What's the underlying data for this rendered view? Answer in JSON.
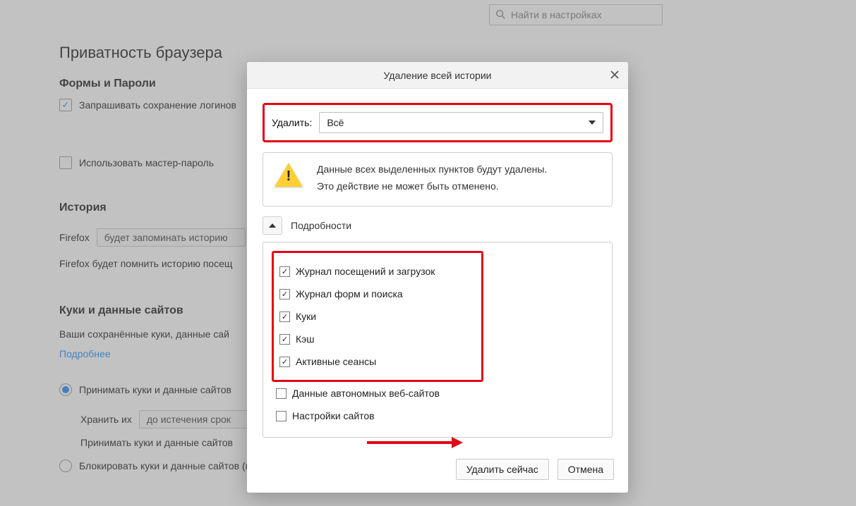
{
  "search": {
    "placeholder": "Найти в настройках"
  },
  "bg": {
    "privacy_title": "Приватность браузера",
    "forms_passwords": "Формы и Пароли",
    "ask_save_logins": "Запрашивать сохранение логинов",
    "use_master_password": "Использовать мастер-пароль",
    "history_title": "История",
    "firefox_label": "Firefox",
    "history_mode": "будет запоминать историю",
    "history_desc": "Firefox будет помнить историю посещ",
    "cookies_title": "Куки и данные сайтов",
    "cookies_desc": "Ваши сохранённые куки, данные сай",
    "learn_more": "Подробнее",
    "accept_cookies": "Принимать куки и данные сайтов",
    "keep_label": "Хранить их",
    "keep_value": "до истечения срок",
    "accept_cookies_dup": "Принимать куки и данные сайтов",
    "block_cookies": "Блокировать куки и данные сайтов (может нарушить работу веб-сайтов)"
  },
  "dialog": {
    "title": "Удаление всей истории",
    "delete_label": "Удалить:",
    "range_value": "Всё",
    "warning_line1": "Данные всех выделенных пунктов будут удалены.",
    "warning_line2": "Это действие не может быть отменено.",
    "details_label": "Подробности",
    "items": {
      "history": "Журнал посещений и загрузок",
      "forms": "Журнал форм и поиска",
      "cookies": "Куки",
      "cache": "Кэш",
      "sessions": "Активные сеансы",
      "offline": "Данные автономных веб-сайтов",
      "site_settings": "Настройки сайтов"
    },
    "btn_delete": "Удалить сейчас",
    "btn_cancel": "Отмена"
  }
}
